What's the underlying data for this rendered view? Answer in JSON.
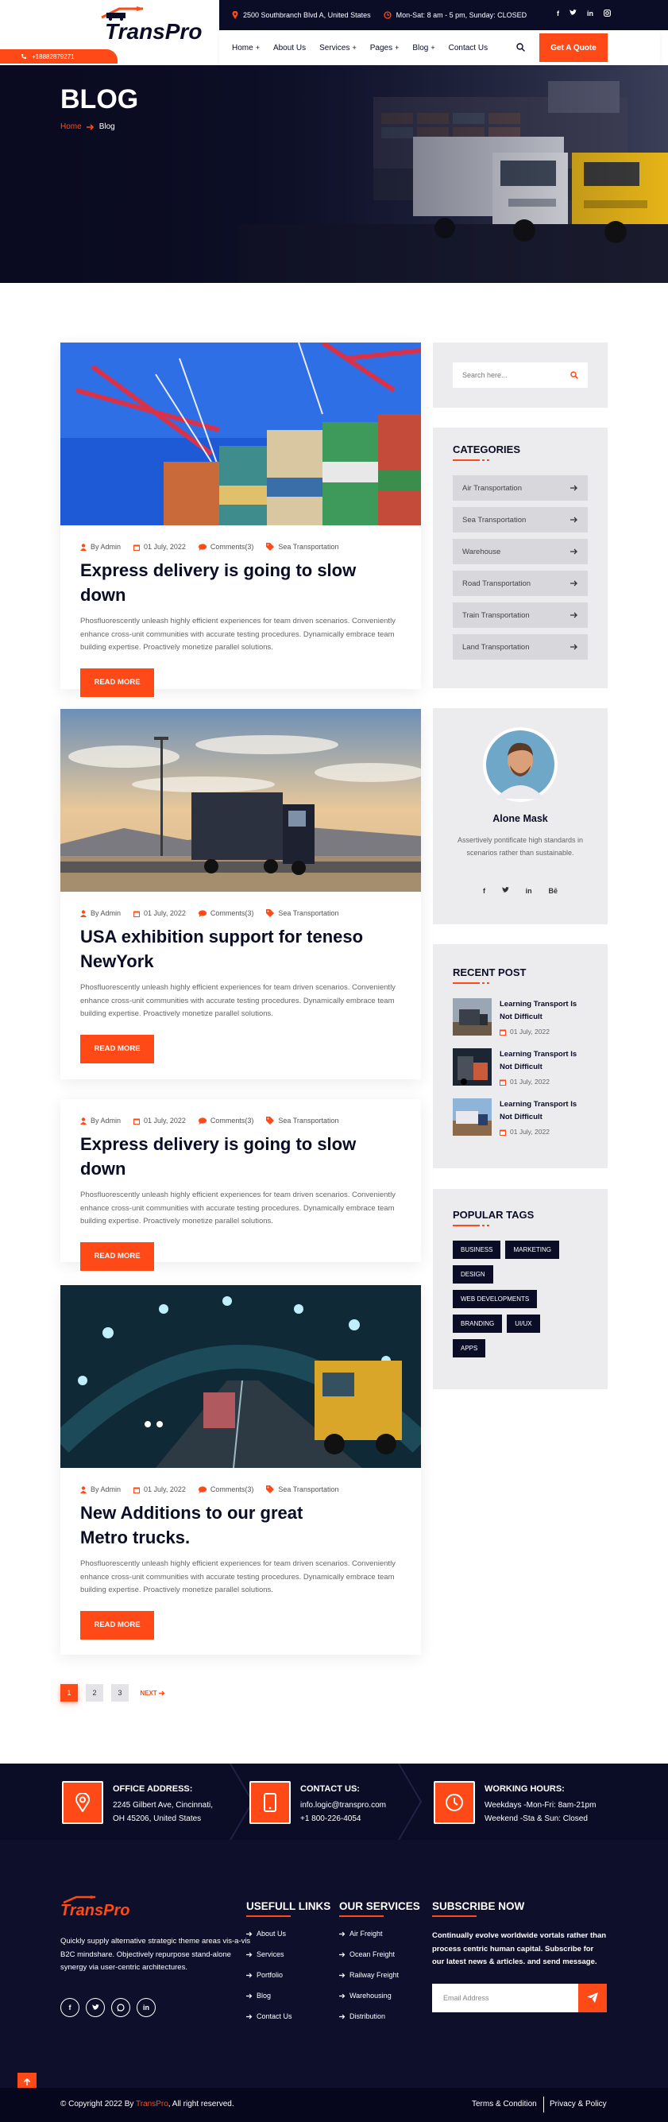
{
  "header": {
    "logo": "TransPro",
    "phone": "+18882879271",
    "address": "2500 Southbranch Blvd A, United States",
    "hours": "Mon-Sat: 8 am - 5 pm, Sunday: CLOSED",
    "nav": [
      {
        "label": "Home",
        "drop": true
      },
      {
        "label": "About Us",
        "drop": false
      },
      {
        "label": "Services",
        "drop": true
      },
      {
        "label": "Pages",
        "drop": true
      },
      {
        "label": "Blog",
        "drop": true
      },
      {
        "label": "Contact Us",
        "drop": false
      }
    ],
    "quote_label": "Get A Quote"
  },
  "hero": {
    "title": "BLOG",
    "crumb_home": "Home",
    "crumb_current": "Blog"
  },
  "posts": [
    {
      "author": "By Admin",
      "date": "01 July, 2022",
      "comments": "Comments(3)",
      "category": "Sea Transportation",
      "title": "Express delivery is going to slow down",
      "excerpt": "Phosfluorescently unleash highly efficient experiences for team driven scenarios. Conveniently enhance cross-unit communities with accurate testing procedures. Dynamically embrace team building expertise. Proactively monetize parallel solutions.",
      "button": "READ MORE"
    },
    {
      "author": "By Admin",
      "date": "01 July, 2022",
      "comments": "Comments(3)",
      "category": "Sea Transportation",
      "title": "USA exhibition support for teneso NewYork",
      "excerpt": "Phosfluorescently unleash highly efficient experiences for team driven scenarios. Conveniently enhance cross-unit communities with accurate testing procedures. Dynamically embrace team building expertise. Proactively monetize parallel solutions.",
      "button": "READ MORE"
    },
    {
      "author": "By Admin",
      "date": "01 July, 2022",
      "comments": "Comments(3)",
      "category": "Sea Transportation",
      "title": "Express delivery is going to slow down",
      "excerpt": "Phosfluorescently unleash highly efficient experiences for team driven scenarios. Conveniently enhance cross-unit communities with accurate testing procedures. Dynamically embrace team building expertise. Proactively monetize parallel solutions.",
      "button": "READ MORE"
    },
    {
      "author": "By Admin",
      "date": "01 July, 2022",
      "comments": "Comments(3)",
      "category": "Sea Transportation",
      "title": "New Additions to our great Metro trucks.",
      "excerpt": "Phosfluorescently unleash highly efficient experiences for team driven scenarios. Conveniently enhance cross-unit communities with accurate testing procedures. Dynamically embrace team building expertise. Proactively monetize parallel solutions.",
      "button": "READ MORE"
    }
  ],
  "pagination": {
    "pages": [
      "1",
      "2",
      "3"
    ],
    "next": "NEXT"
  },
  "sidebar": {
    "search_placeholder": "Search here...",
    "categories_title": "CATEGORIES",
    "categories": [
      "Air Transportation",
      "Sea Transportation",
      "Warehouse",
      "Road Transportation",
      "Train Transportation",
      "Land Transportation"
    ],
    "author": {
      "name": "Alone Mask",
      "bio": "Assertively pontificate high standards in scenarios rather than sustainable."
    },
    "recent_title": "RECENT POST",
    "recent": [
      {
        "title": "Learning Transport Is Not Difficult",
        "date": "01 July, 2022"
      },
      {
        "title": "Learning Transport Is Not Difficult",
        "date": "01 July, 2022"
      },
      {
        "title": "Learning Transport Is Not Difficult",
        "date": "01 July, 2022"
      }
    ],
    "tags_title": "POPULAR TAGS",
    "tags": [
      "BUSINESS",
      "MARKETING",
      "DESIGN",
      "WEB DEVELOPMENTS",
      "BRANDING",
      "UI/UX",
      "APPS"
    ]
  },
  "contact": [
    {
      "heading": "OFFICE ADDRESS:",
      "line1": "2245 Gilbert Ave, Cincinnati,",
      "line2": "OH 45206, United States"
    },
    {
      "heading": "CONTACT US:",
      "line1": "info.logic@transpro.com",
      "line2": "+1 800-226-4054"
    },
    {
      "heading": "WORKING HOURS:",
      "line1": "Weekdays -Mon-Fri: 8am-21pm",
      "line2": "Weekend -Sta & Sun: Closed"
    }
  ],
  "footer": {
    "logo": "TransPro",
    "about": "Quickly supply alternative strategic theme areas vis-a-vis B2C mindshare. Objectively repurpose stand-alone synergy via user-centric architectures.",
    "links_title": "USEFULL LINKS",
    "links": [
      "About Us",
      "Services",
      "Portfolio",
      "Blog",
      "Contact Us"
    ],
    "services_title": "OUR SERVICES",
    "services": [
      "Air Freight",
      "Ocean Freight",
      "Railway Freight",
      "Warehousing",
      "Distribution"
    ],
    "subscribe_title": "SUBSCRIBE NOW",
    "subscribe_text": "Continually evolve worldwide vortals rather than process centric human capital. Subscribe for our latest news & articles. and send message.",
    "email_placeholder": "Email Address"
  },
  "bottom": {
    "copyright_pre": "© Copyright 2022 By ",
    "brand": "TransPro",
    "copyright_post": ", All right reserved.",
    "terms": "Terms & Condition",
    "privacy": "Privacy & Policy"
  },
  "colors": {
    "accent": "#ff4a17",
    "dark": "#0b0d26",
    "sidebar": "#ececef"
  }
}
